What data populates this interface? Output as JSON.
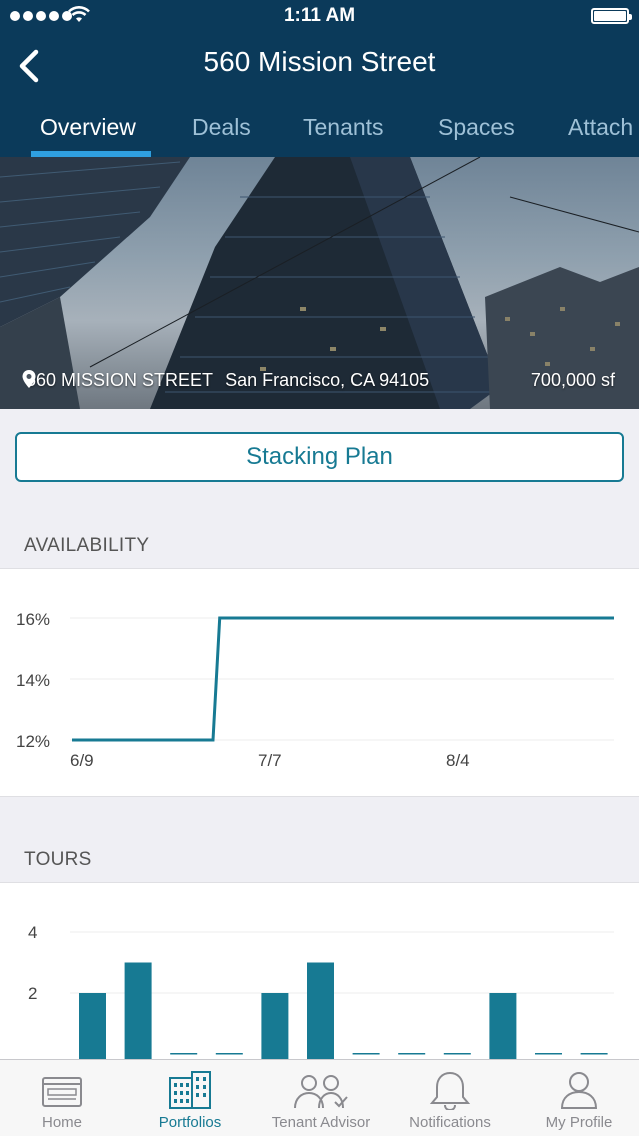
{
  "status_bar": {
    "time": "1:11 AM"
  },
  "header": {
    "title": "560 Mission Street",
    "back_icon": "chevron-left-icon"
  },
  "tabs": [
    {
      "label": "Overview",
      "active": true
    },
    {
      "label": "Deals",
      "active": false
    },
    {
      "label": "Tenants",
      "active": false
    },
    {
      "label": "Spaces",
      "active": false
    },
    {
      "label": "Attach",
      "active": false
    }
  ],
  "hero": {
    "address": "560 MISSION STREET",
    "city": "San Francisco, CA 94105",
    "size": "700,000 sf",
    "pin_icon": "map-pin-icon"
  },
  "stacking_plan_label": "Stacking Plan",
  "availability": {
    "label": "AVAILABILITY",
    "chart_data": {
      "type": "line",
      "x_tick_labels": [
        "6/9",
        "7/7",
        "8/4"
      ],
      "y_tick_labels": [
        "16%",
        "14%",
        "12%"
      ],
      "ylim": [
        12,
        16
      ],
      "points": [
        {
          "x": "6/9",
          "y": 12
        },
        {
          "x": "6/30",
          "y": 12
        },
        {
          "x": "7/1",
          "y": 16
        },
        {
          "x": "8/30",
          "y": 16
        }
      ],
      "color": "#177a93",
      "grid": true
    }
  },
  "tours": {
    "label": "TOURS",
    "chart_data": {
      "type": "bar",
      "y_tick_labels": [
        "4",
        "2"
      ],
      "ylim": [
        0,
        4
      ],
      "values": [
        2,
        3,
        0,
        0,
        2,
        3,
        0,
        0,
        0,
        2,
        0,
        0
      ],
      "color": "#177a93",
      "grid": true
    }
  },
  "tabbar": [
    {
      "label": "Home",
      "icon": "home-icon",
      "active": false
    },
    {
      "label": "Portfolios",
      "icon": "portfolios-icon",
      "active": true
    },
    {
      "label": "Tenant Advisor",
      "icon": "tenant-advisor-icon",
      "active": false
    },
    {
      "label": "Notifications",
      "icon": "bell-icon",
      "active": false
    },
    {
      "label": "My Profile",
      "icon": "profile-icon",
      "active": false
    }
  ]
}
